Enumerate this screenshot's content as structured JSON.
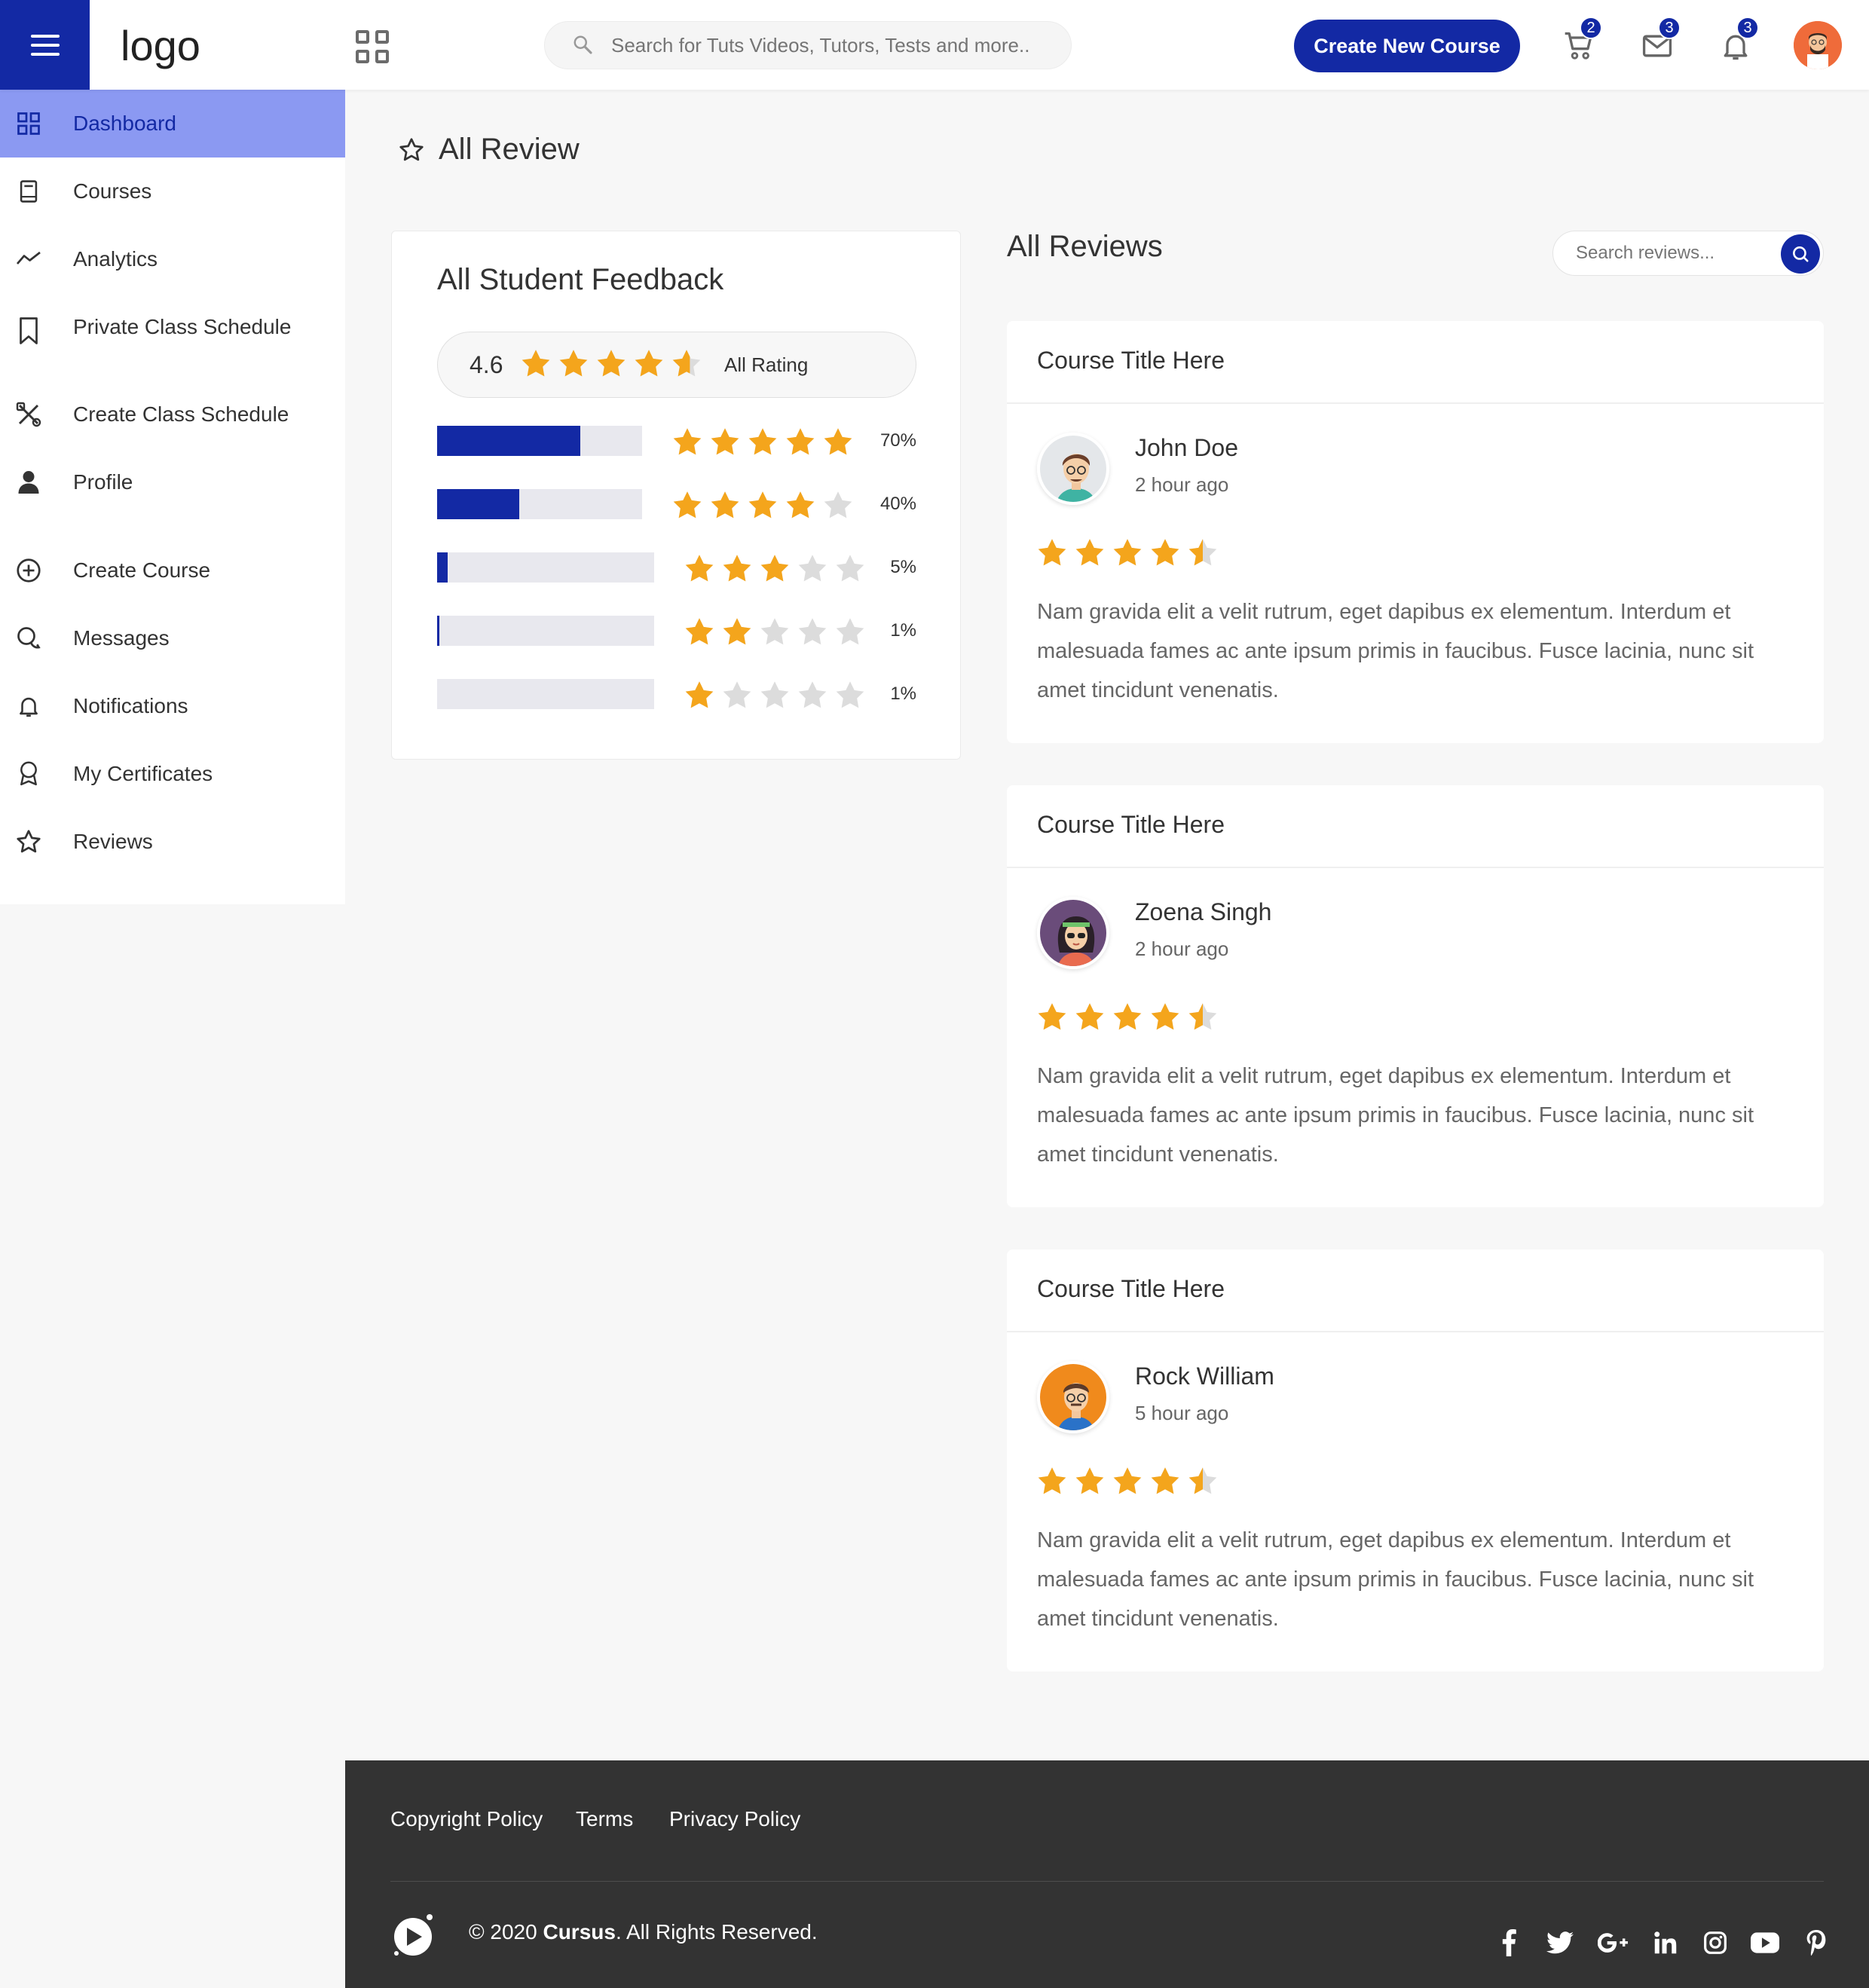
{
  "header": {
    "logo_text": "logo",
    "search_placeholder": "Search for Tuts Videos, Tutors, Tests and more..",
    "create_button": "Create New Course",
    "cart_count": "2",
    "mail_count": "3",
    "notification_count": "3"
  },
  "sidebar": {
    "items": [
      {
        "label": "Dashboard",
        "icon": "dashboard-icon"
      },
      {
        "label": "Courses",
        "icon": "book-icon"
      },
      {
        "label": "Analytics",
        "icon": "trend-icon"
      },
      {
        "label": "Private Class Schedule",
        "icon": "bookmark-icon"
      },
      {
        "label": "Create Class Schedule",
        "icon": "tools-icon"
      },
      {
        "label": "Profile",
        "icon": "user-icon"
      },
      {
        "label": "Create Course",
        "icon": "plus-circle-icon"
      },
      {
        "label": "Messages",
        "icon": "chat-icon"
      },
      {
        "label": "Notifications",
        "icon": "bell-icon"
      },
      {
        "label": "My Certificates",
        "icon": "award-icon"
      },
      {
        "label": "Reviews",
        "icon": "star-icon"
      }
    ]
  },
  "page": {
    "title": "All Review"
  },
  "feedback": {
    "title": "All Student Feedback",
    "overall_rating": "4.6",
    "overall_rating_value": 4.6,
    "rating_label": "All Rating",
    "breakdown": [
      {
        "stars": 5,
        "percent_label": "70%",
        "percent": 70
      },
      {
        "stars": 4,
        "percent_label": "40%",
        "percent": 40
      },
      {
        "stars": 3,
        "percent_label": "5%",
        "percent": 5
      },
      {
        "stars": 2,
        "percent_label": "1%",
        "percent": 1
      },
      {
        "stars": 1,
        "percent_label": "1%",
        "percent": 1
      }
    ]
  },
  "reviews": {
    "title": "All Reviews",
    "search_placeholder": "Search reviews...",
    "items": [
      {
        "course": "Course Title Here",
        "name": "John Doe",
        "time": "2 hour ago",
        "rating": 4.5,
        "text": "Nam gravida elit a velit rutrum, eget dapibus ex elementum. Interdum et malesuada fames ac ante ipsum primis in faucibus. Fusce lacinia, nunc sit amet tincidunt venenatis."
      },
      {
        "course": "Course Title Here",
        "name": "Zoena Singh",
        "time": "2 hour ago",
        "rating": 4.5,
        "text": "Nam gravida elit a velit rutrum, eget dapibus ex elementum. Interdum et malesuada fames ac ante ipsum primis in faucibus. Fusce lacinia, nunc sit amet tincidunt venenatis."
      },
      {
        "course": "Course Title Here",
        "name": "Rock William",
        "time": "5 hour ago",
        "rating": 4.5,
        "text": "Nam gravida elit a velit rutrum, eget dapibus ex elementum. Interdum et malesuada fames ac ante ipsum primis in faucibus. Fusce lacinia, nunc sit amet tincidunt venenatis."
      }
    ]
  },
  "footer": {
    "links": [
      "Copyright Policy",
      "Terms",
      "Privacy Policy"
    ],
    "copyright_prefix": "© 2020 ",
    "brand": "Cursus",
    "copyright_suffix": ". All Rights Reserved.",
    "social": [
      "facebook-icon",
      "twitter-icon",
      "google-plus-icon",
      "linkedin-icon",
      "instagram-icon",
      "youtube-icon",
      "pinterest-icon"
    ]
  },
  "colors": {
    "primary": "#1329a4",
    "active_bg": "#8b99f2",
    "star": "#f4a51c",
    "star_empty": "#dcdcdc",
    "footer_bg": "#333333"
  }
}
